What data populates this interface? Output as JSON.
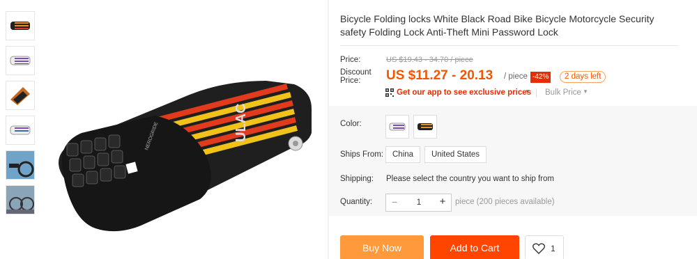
{
  "product": {
    "title": "Bicycle Folding locks White Black Road Bike Bicycle Motorcycle Security safety Folding Lock Anti-Theft Mini Password Lock"
  },
  "price": {
    "label": "Price:",
    "original": "US $19.43 - 34.70 / piece",
    "discount_label": "Discount Price:",
    "discount_value": "US $11.27 - 20.13",
    "unit": "/ piece",
    "discount_badge": "-42%",
    "time_left": "2 days left",
    "app_promo": "Get our app to see exclusive prices",
    "bulk_price": "Bulk Price"
  },
  "options": {
    "color_label": "Color:",
    "ships_from_label": "Ships From:",
    "ships_from": [
      "China",
      "United States"
    ],
    "shipping_label": "Shipping:",
    "shipping_text": "Please select the country you want to ship from",
    "quantity_label": "Quantity:",
    "quantity_value": "1",
    "quantity_minus": "−",
    "quantity_plus": "+",
    "quantity_note": "piece (200 pieces available)"
  },
  "actions": {
    "buy_now": "Buy Now",
    "add_to_cart": "Add to Cart",
    "wishlist_count": "1"
  },
  "icons": {
    "qr": "qr-code-icon",
    "dropdown": "chevron-down-icon",
    "wishlist": "heart-icon"
  },
  "colors": {
    "accent": "#f45500",
    "buy_button": "#ff9a3c",
    "cart_button": "#ff4500",
    "badge": "#e62e04"
  },
  "brand_mark": "ULAC",
  "brand_model": "NEROGRIDE"
}
